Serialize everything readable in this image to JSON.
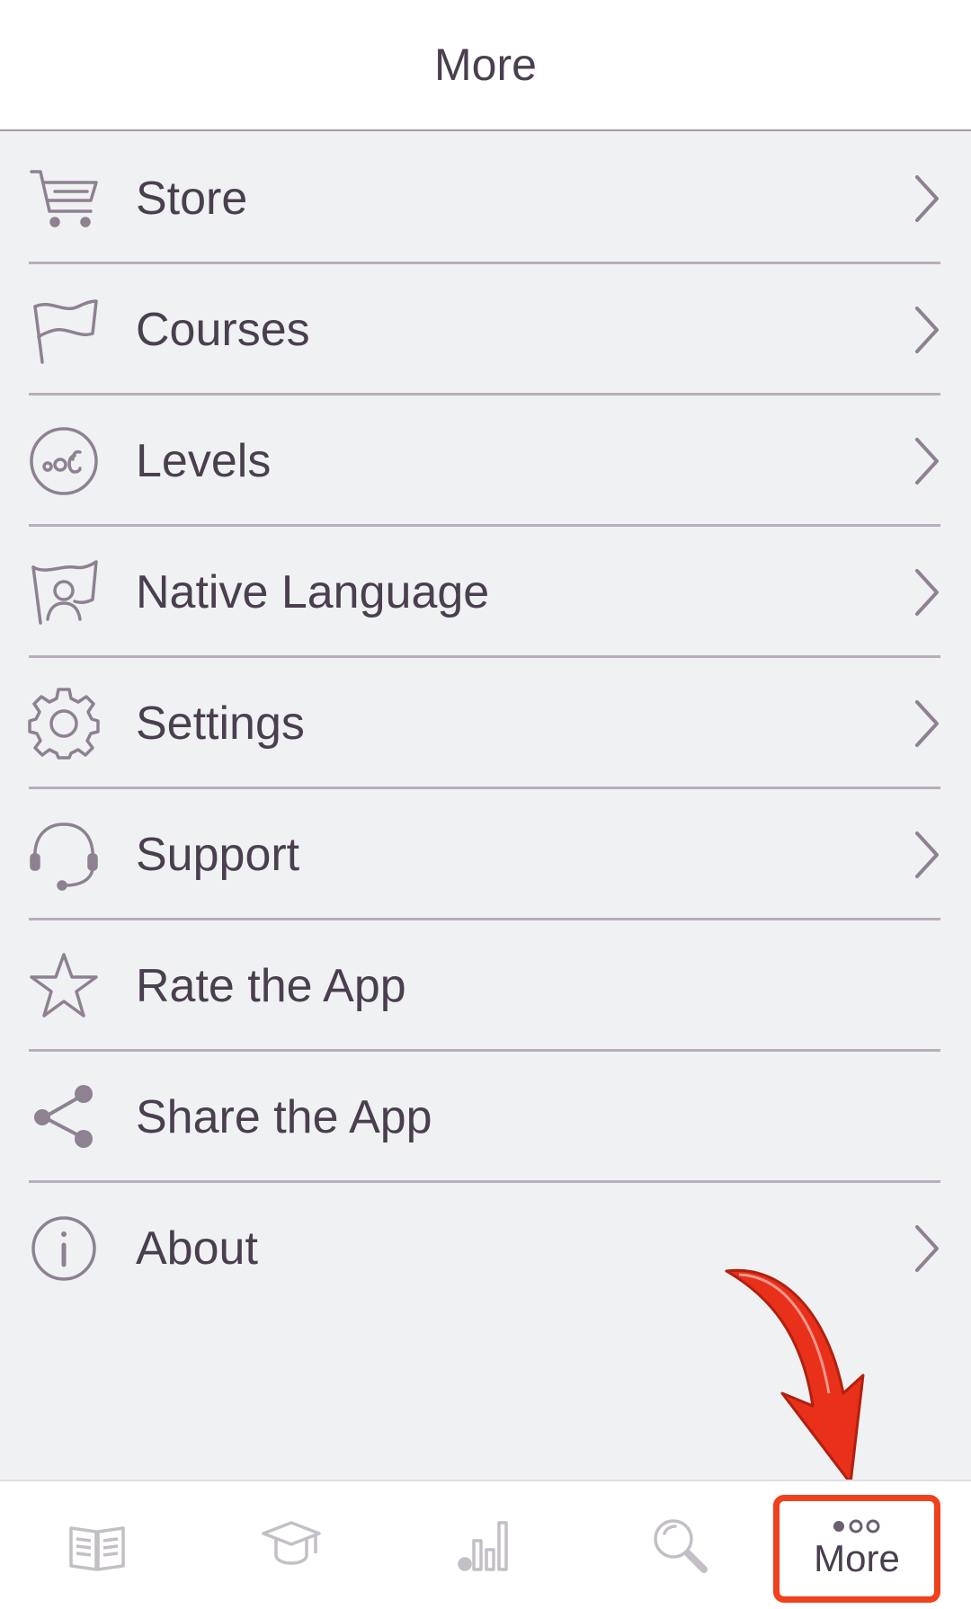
{
  "header": {
    "title": "More"
  },
  "menu": {
    "items": [
      {
        "label": "Store",
        "icon": "cart-icon",
        "chevron": true
      },
      {
        "label": "Courses",
        "icon": "flag-icon",
        "chevron": true
      },
      {
        "label": "Levels",
        "icon": "levels-icon",
        "chevron": true
      },
      {
        "label": "Native Language",
        "icon": "native-language-icon",
        "chevron": true
      },
      {
        "label": "Settings",
        "icon": "gear-icon",
        "chevron": true
      },
      {
        "label": "Support",
        "icon": "headset-icon",
        "chevron": true
      },
      {
        "label": "Rate the App",
        "icon": "star-icon",
        "chevron": false
      },
      {
        "label": "Share the App",
        "icon": "share-icon",
        "chevron": false
      },
      {
        "label": "About",
        "icon": "info-icon",
        "chevron": true
      }
    ]
  },
  "tabbar": {
    "tabs": [
      {
        "icon": "book-icon"
      },
      {
        "icon": "graduation-cap-icon"
      },
      {
        "icon": "stats-icon"
      },
      {
        "icon": "search-icon"
      },
      {
        "icon": "more-dots-icon",
        "label": "More",
        "active": true
      }
    ]
  },
  "colors": {
    "text": "#4a3f4f",
    "icon": "#8e8192",
    "divider": "#b8adbb",
    "background": "#f0f1f3",
    "highlight": "#f0401c"
  }
}
